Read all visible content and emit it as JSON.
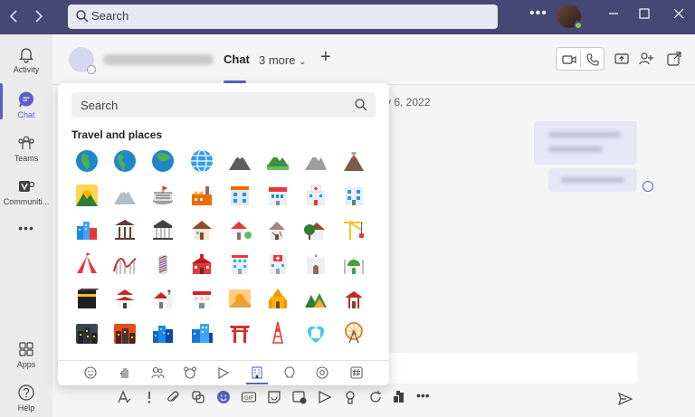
{
  "titlebar": {
    "search_placeholder": "Search",
    "more_label": "•••",
    "back_icon": "chevron-left-icon",
    "forward_icon": "chevron-right-icon"
  },
  "rail": {
    "items": [
      {
        "label": "Activity",
        "icon": "bell-icon"
      },
      {
        "label": "Chat",
        "icon": "chat-icon",
        "active": true
      },
      {
        "label": "Teams",
        "icon": "teams-icon"
      },
      {
        "label": "Communiti...",
        "icon": "communities-icon"
      },
      {
        "label": "•••",
        "icon": "more-icon"
      },
      {
        "label": "Apps",
        "icon": "apps-icon"
      },
      {
        "label": "Help",
        "icon": "help-icon"
      }
    ]
  },
  "header": {
    "tab_chat": "Chat",
    "tab_more": "3 more",
    "add_tab": "+"
  },
  "chat": {
    "date_fragment": "ry 6, 2022"
  },
  "picker": {
    "search_placeholder": "Search",
    "category_title": "Travel and places",
    "emoji_names": [
      [
        "globe-africa",
        "globe-americas",
        "globe-asia",
        "globe-meridians",
        "snowcapped-mountain",
        "mountain-green",
        "mountain-grey",
        "volcano"
      ],
      [
        "sunrise-mountains",
        "mount-fuji",
        "stadium",
        "factory",
        "office-building",
        "japanese-post-office",
        "hospital",
        "bank"
      ],
      [
        "cityscape",
        "classical-building",
        "classical-temple",
        "house",
        "house-with-garden",
        "derelict-house",
        "house-tree",
        "construction-crane"
      ],
      [
        "circus-tent",
        "roller-coaster",
        "barber-pole",
        "school",
        "hotel",
        "hospital-red-cross",
        "castle",
        "mosque"
      ],
      [
        "kaaba",
        "japanese-castle",
        "church",
        "department-store",
        "sunrise-desert",
        "hindu-temple",
        "camping",
        "shinto-shrine"
      ],
      [
        "night-city",
        "cityscape-dusk",
        "city-blue",
        "buildings-blue",
        "torii-gate",
        "tokyo-tower",
        "wedding-heart",
        "ferris-wheel"
      ]
    ],
    "category_tabs": [
      "smile-icon",
      "hand-icon",
      "people-icon",
      "animal-icon",
      "food-icon",
      "travel-icon",
      "activities-icon",
      "objects-icon",
      "symbols-icon"
    ],
    "active_tab": "travel-icon"
  },
  "compose_toolbar": [
    "format-icon",
    "important-icon",
    "attach-icon",
    "loop-icon",
    "emoji-icon",
    "gif-icon",
    "sticker-icon",
    "schedule-icon",
    "stream-icon",
    "praise-icon",
    "whiteboard-icon",
    "apps-icon",
    "more-icon"
  ],
  "colors": {
    "titlebar": "#464775",
    "accent": "#5b5fc7",
    "rail": "#ebebeb",
    "background": "#f5f5f5"
  }
}
